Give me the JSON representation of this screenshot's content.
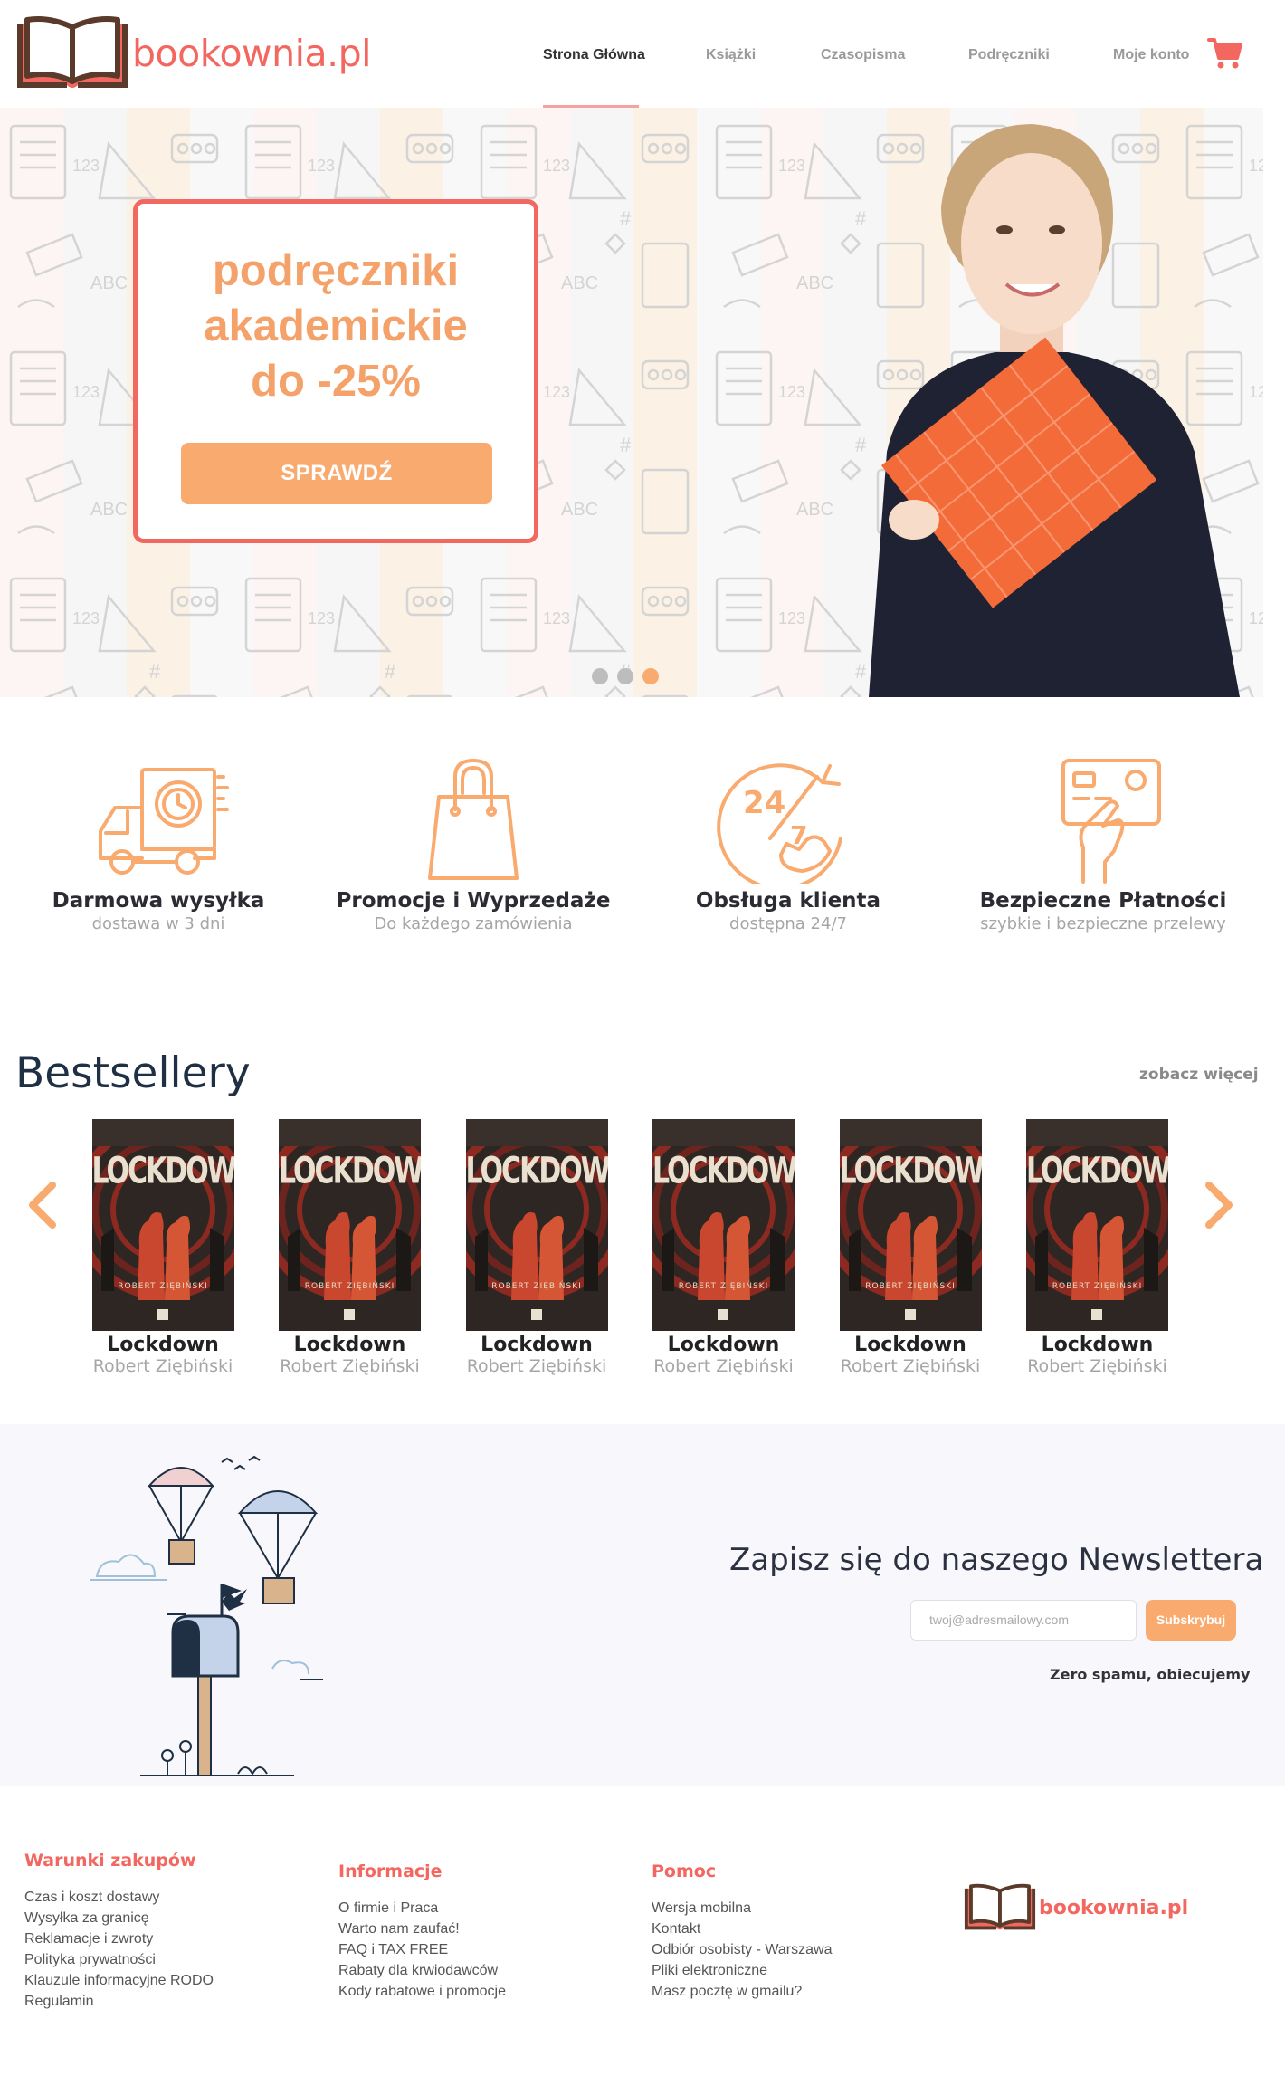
{
  "brand": {
    "name": "bookownia.pl",
    "accent": "#f2675f",
    "orange": "#f9aa6f"
  },
  "nav": {
    "items": [
      {
        "label": "Strona Główna",
        "active": true
      },
      {
        "label": "Książki"
      },
      {
        "label": "Czasopisma"
      },
      {
        "label": "Podręczniki"
      },
      {
        "label": "Moje konto"
      }
    ],
    "cart_icon": "cart-icon"
  },
  "hero": {
    "promo_line1": "podręczniki",
    "promo_line2": "akademickie",
    "promo_line3": "do -25%",
    "button_label": "SPRAWDŹ",
    "slides_total": 3,
    "active_slide": 3
  },
  "features": [
    {
      "icon": "delivery-truck-icon",
      "title": "Darmowa wysyłka",
      "subtitle": "dostawa w 3 dni"
    },
    {
      "icon": "shopping-bag-icon",
      "title": "Promocje i Wyprzedaże",
      "subtitle": "Do każdego zamówienia"
    },
    {
      "icon": "support-24-7-icon",
      "title": "Obsługa klienta",
      "subtitle": "dostępna 24/7"
    },
    {
      "icon": "card-payment-icon",
      "title": "Bezpieczne Płatności",
      "subtitle": "szybkie i bezpieczne przelewy"
    }
  ],
  "bestsellers": {
    "title": "Bestsellery",
    "see_more": "zobacz więcej",
    "books": [
      {
        "title": "Lockdown",
        "author": "Robert Ziębiński",
        "cover_title": "LOCKDOWN",
        "cover_author": "ROBERT ZIĘBIŃSKI"
      },
      {
        "title": "Lockdown",
        "author": "Robert Ziębiński",
        "cover_title": "LOCKDOWN",
        "cover_author": "ROBERT ZIĘBIŃSKI"
      },
      {
        "title": "Lockdown",
        "author": "Robert Ziębiński",
        "cover_title": "LOCKDOWN",
        "cover_author": "ROBERT ZIĘBIŃSKI"
      },
      {
        "title": "Lockdown",
        "author": "Robert Ziębiński",
        "cover_title": "LOCKDOWN",
        "cover_author": "ROBERT ZIĘBIŃSKI"
      },
      {
        "title": "Lockdown",
        "author": "Robert Ziębiński",
        "cover_title": "LOCKDOWN",
        "cover_author": "ROBERT ZIĘBIŃSKI"
      },
      {
        "title": "Lockdown",
        "author": "Robert Ziębiński",
        "cover_title": "LOCKDOWN",
        "cover_author": "ROBERT ZIĘBIŃSKI"
      }
    ]
  },
  "newsletter": {
    "title": "Zapisz się do naszego Newslettera",
    "placeholder": "twoj@adresmailowy.com",
    "button": "Subskrybuj",
    "note": "Zero spamu, obiecujemy"
  },
  "footer": {
    "columns": [
      {
        "heading": "Warunki zakupów",
        "links": [
          "Czas i koszt dostawy",
          "Wysyłka za granicę",
          "Reklamacje i zwroty",
          "Polityka prywatności",
          "Klauzule informacyjne RODO",
          "Regulamin"
        ]
      },
      {
        "heading": "Informacje",
        "links": [
          "O firmie i Praca",
          "Warto nam zaufać!",
          "FAQ i TAX FREE",
          "Rabaty dla krwiodawców",
          "Kody rabatowe i promocje"
        ]
      },
      {
        "heading": "Pomoc",
        "links": [
          "Wersja mobilna",
          "Kontakt",
          "Odbiór osobisty - Warszawa",
          "Pliki elektroniczne",
          "Masz pocztę w gmailu?"
        ]
      }
    ],
    "brand": "bookownia.pl"
  }
}
